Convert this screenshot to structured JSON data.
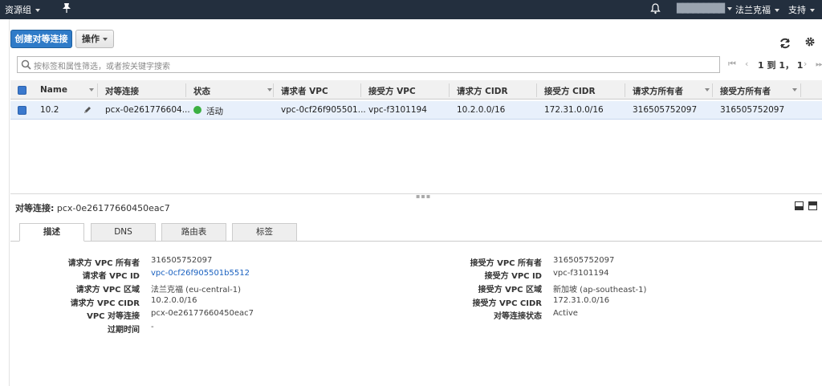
{
  "topbar": {
    "resource_groups": "资源组",
    "username": "█████████",
    "region": "法兰克福",
    "support": "支持"
  },
  "toolbar": {
    "create_label": "创建对等连接",
    "actions_label": "操作"
  },
  "search": {
    "placeholder": "按标签和属性筛选，或者按关键字搜索"
  },
  "pager": {
    "text": "1 到 1， 1"
  },
  "table": {
    "columns": [
      "Name",
      "对等连接",
      "状态",
      "请求者 VPC",
      "接受方 VPC",
      "请求方 CIDR",
      "接受方 CIDR",
      "请求方所有者",
      "接受方所有者"
    ],
    "rows": [
      {
        "name": "10.2",
        "peering": "pcx-0e261776604...",
        "status": "活动",
        "requester_vpc": "vpc-0cf26f905501...",
        "accepter_vpc": "vpc-f3101194",
        "requester_cidr": "10.2.0.0/16",
        "accepter_cidr": "172.31.0.0/16",
        "requester_owner": "316505752097",
        "accepter_owner": "316505752097"
      }
    ]
  },
  "detail": {
    "title_label": "对等连接:",
    "title_value": "pcx-0e26177660450eac7",
    "tabs": [
      "描述",
      "DNS",
      "路由表",
      "标签"
    ],
    "left": [
      {
        "label": "请求方 VPC 所有者",
        "value": "316505752097"
      },
      {
        "label": "请求者 VPC ID",
        "value": "vpc-0cf26f905501b5512"
      },
      {
        "label": "请求方 VPC 区域",
        "value": "法兰克福 (eu-central-1)"
      },
      {
        "label": "请求方 VPC CIDR",
        "value": "10.2.0.0/16"
      },
      {
        "label": "VPC 对等连接",
        "value": "pcx-0e26177660450eac7"
      },
      {
        "label": "过期时间",
        "value": "-"
      }
    ],
    "right": [
      {
        "label": "接受方 VPC 所有者",
        "value": "316505752097"
      },
      {
        "label": "接受方 VPC ID",
        "value": "vpc-f3101194"
      },
      {
        "label": "接受方 VPC 区域",
        "value": "新加坡 (ap-southeast-1)"
      },
      {
        "label": "接受方 VPC CIDR",
        "value": "172.31.0.0/16"
      },
      {
        "label": "对等连接状态",
        "value": "Active"
      }
    ]
  },
  "colors": {
    "topbar": "#232f3e",
    "primary_button": "#2f7bc8",
    "selected_row": "#e8f0fb",
    "status_active": "#3cb043",
    "link": "#1a61c0"
  }
}
